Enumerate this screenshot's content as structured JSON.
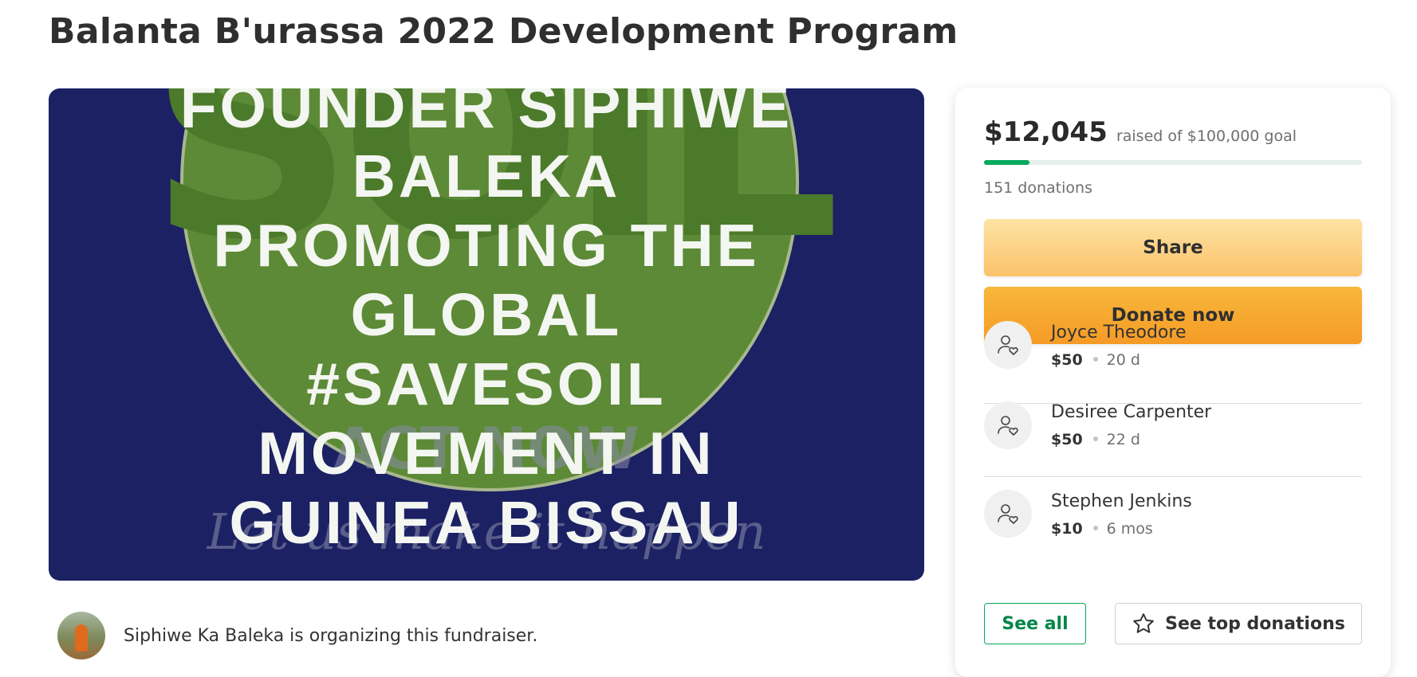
{
  "page": {
    "title": "Balanta B'urassa 2022 Development Program"
  },
  "hero": {
    "lines": [
      "FOUNDER SIPHIWE",
      "BALEKA",
      "PROMOTING THE",
      "GLOBAL",
      "#SAVESOIL",
      "MOVEMENT IN",
      "GUINEA BISSAU"
    ],
    "background_word": "SOIL",
    "faint_line_1": "ACT NOW",
    "faint_line_2": "Let us make it happen",
    "colors": {
      "background": "#1b2163",
      "circle": "#5c8a36",
      "text": "#f4f6f2"
    }
  },
  "organizer": {
    "text": "Siphiwe Ka Baleka is organizing this fundraiser."
  },
  "summary": {
    "raised": "$12,045",
    "goal_text": "raised of $100,000 goal",
    "progress_fraction": 0.12045,
    "donations_count": "151 donations"
  },
  "buttons": {
    "share": "Share",
    "donate": "Donate now",
    "see_all": "See all",
    "see_top": "See top donations"
  },
  "donors": [
    {
      "name": "Joyce Theodore",
      "amount": "$50",
      "time": "20 d",
      "icon": "donor-heart-icon"
    },
    {
      "name": "Desiree Carpenter",
      "amount": "$50",
      "time": "22 d",
      "icon": "donor-heart-icon"
    },
    {
      "name": "Stephen Jenkins",
      "amount": "$10",
      "time": "6 mos",
      "icon": "donor-heart-icon"
    }
  ],
  "colors": {
    "accent": "#02a95c",
    "share_button": "#fbc26a",
    "donate_button": "#f59b26"
  }
}
